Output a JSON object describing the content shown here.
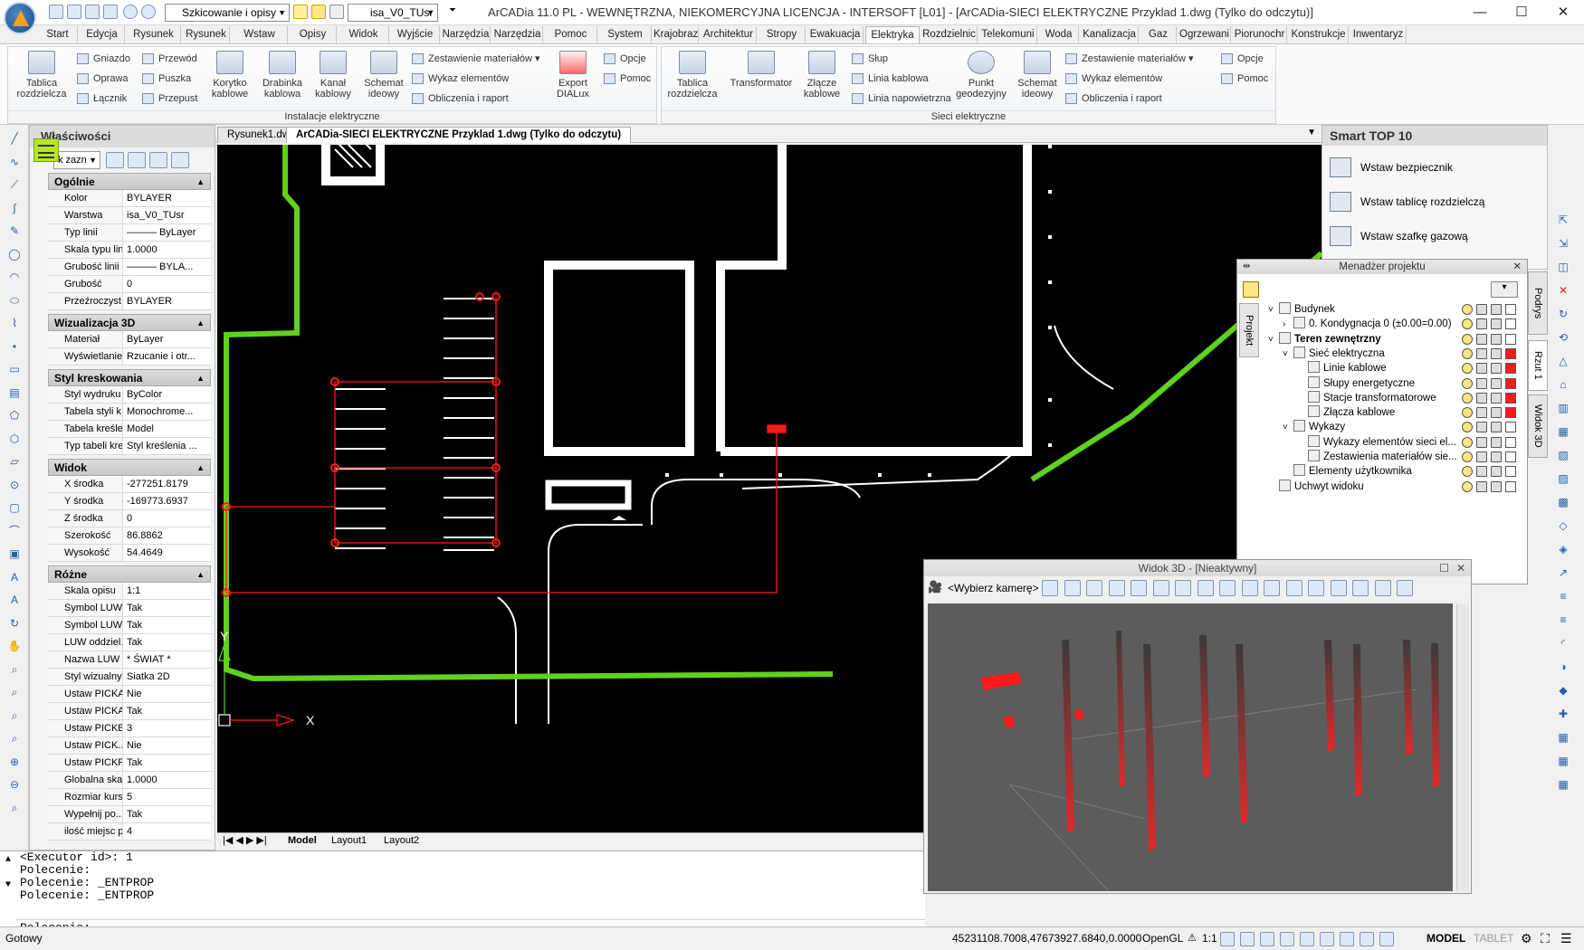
{
  "window": {
    "title": "ArCADia 11.0 PL - WEWNĘTRZNA, NIEKOMERCYJNA LICENCJA - INTERSOFT [L01] - [ArCADia-SIECI ELEKTRYCZNE Przyklad 1.dwg (Tylko do odczytu)]",
    "workspace": "Szkicowanie i opisy",
    "layer": "isa_V0_TUsr",
    "minimize": "—",
    "maximize": "☐",
    "close": "✕"
  },
  "ribbon_tabs": [
    "Start",
    "Edycja",
    "Rysunek 2D",
    "Rysunek 3D",
    "Wstaw",
    "Opisy",
    "Widok",
    "Wyjście",
    "Narzędzia",
    "Narzędzia e",
    "Pomoc",
    "System",
    "Krajobraz",
    "Architektur",
    "Stropy",
    "Ewakuacja",
    "Elektryka",
    "Rozdzielnic",
    "Telekomuni",
    "Woda",
    "Kanalizacja",
    "Gaz",
    "Ogrzewani",
    "Piorunochr",
    "Konstrukcje",
    "Inwentaryz"
  ],
  "ribbon": {
    "group1": {
      "label": "Instalacje elektryczne",
      "tablica": "Tablica rozdzielcza",
      "gniazdo": "Gniazdo",
      "oprawa": "Oprawa",
      "lacznik": "Łącznik",
      "przewod": "Przewód",
      "puszka": "Puszka",
      "przepust": "Przepust",
      "korytko": "Korytko kablowe",
      "drabinka": "Drabinka kablowa",
      "kanal": "Kanał kablowy",
      "schemat": "Schemat ideowy",
      "zestawienie": "Zestawienie materiałów",
      "wykaz": "Wykaz elementów",
      "obliczenia": "Obliczenia i raport",
      "export": "Export DIALux",
      "opcje": "Opcje",
      "pomoc": "Pomoc"
    },
    "group2": {
      "label": "Sieci elektryczne",
      "tablica": "Tablica rozdzielcza",
      "transformator": "Transformator",
      "zlacze": "Złącze kablowe",
      "slup": "Słup",
      "linia_kablowa": "Linia kablowa",
      "linia_napowietrzna": "Linia napowietrzna",
      "punkt": "Punkt geodezyjny",
      "schemat": "Schemat ideowy",
      "zestawienie": "Zestawienie materiałów",
      "wykaz": "Wykaz elementów",
      "obliczenia": "Obliczenia i raport",
      "opcje": "Opcje",
      "pomoc": "Pomoc"
    }
  },
  "properties": {
    "title": "Właściwości",
    "selector": "k zazn",
    "sections": [
      {
        "name": "Ogólnie",
        "rows": [
          [
            "Kolor",
            "BYLAYER"
          ],
          [
            "Warstwa",
            "isa_V0_TUsr"
          ],
          [
            "Typ linii",
            "——— ByLayer"
          ],
          [
            "Skala typu linii",
            "1.0000"
          ],
          [
            "Grubość linii",
            "——— BYLA..."
          ],
          [
            "Grubość",
            "0"
          ],
          [
            "Przeźroczyst...",
            "BYLAYER"
          ]
        ]
      },
      {
        "name": "Wizualizacja 3D",
        "rows": [
          [
            "Materiał",
            "ByLayer"
          ],
          [
            "Wyświetlanie...",
            "Rzucanie i otr..."
          ]
        ]
      },
      {
        "name": "Styl kreskowania",
        "rows": [
          [
            "Styl wydruku",
            "ByColor"
          ],
          [
            "Tabela styli k...",
            "Monochrome..."
          ],
          [
            "Tabela kreśle...",
            "Model"
          ],
          [
            "Typ tabeli kre...",
            "Styl kreślenia ..."
          ]
        ]
      },
      {
        "name": "Widok",
        "rows": [
          [
            "X środka",
            "-277251.8179"
          ],
          [
            "Y środka",
            "-169773.6937"
          ],
          [
            "Z środka",
            "0"
          ],
          [
            "Szerokość",
            "86.8862"
          ],
          [
            "Wysokość",
            "54.4649"
          ]
        ]
      },
      {
        "name": "Różne",
        "rows": [
          [
            "Skala opisu",
            "1:1"
          ],
          [
            "Symbol LUW...",
            "Tak"
          ],
          [
            "Symbol LUW...",
            "Tak"
          ],
          [
            "LUW oddziel...",
            "Tak"
          ],
          [
            "Nazwa LUW",
            "* ŚWIAT *"
          ],
          [
            "Styl wizualny",
            "Siatka 2D"
          ],
          [
            "Ustaw PICKA...",
            "Nie"
          ],
          [
            "Ustaw PICKA...",
            "Tak"
          ],
          [
            "Ustaw PICKB...",
            "3"
          ],
          [
            "Ustaw PICK...",
            "Nie"
          ],
          [
            "Ustaw PICKF...",
            "Tak"
          ],
          [
            "Globalna skal...",
            "1.0000"
          ],
          [
            "Rozmiar kurs...",
            "5"
          ],
          [
            "Wypełnij po...",
            "Tak"
          ],
          [
            "ilość miejsc p...",
            "4"
          ]
        ]
      }
    ]
  },
  "doc_tabs": [
    "Rysunek1.dwg",
    "ArCADia-SIECI ELEKTRYCZNE Przyklad 1.dwg (Tylko do odczytu)"
  ],
  "layout_tabs": [
    "Model",
    "Layout1",
    "Layout2"
  ],
  "ucs": {
    "x": "X",
    "y": "Y"
  },
  "command_line": {
    "history": [
      "<Executor id>: 1",
      "Polecenie:",
      "Polecenie: _ENTPROP",
      "Polecenie: _ENTPROP"
    ],
    "prompt": "Polecenie:"
  },
  "status": {
    "ready": "Gotowy",
    "coords": "45231108.7008,47673927.6840,0.0000",
    "renderer": "OpenGL",
    "scale": "1:1",
    "model": "MODEL",
    "tablet": "TABLET"
  },
  "smart_top": {
    "title": "Smart TOP 10",
    "items": [
      "Wstaw bezpiecznik",
      "Wstaw tablicę rozdzielczą",
      "Wstaw szafkę gazową"
    ]
  },
  "project_manager": {
    "title": "Menadżer projektu",
    "tab": "Projekt",
    "rows": [
      {
        "label": "Budynek",
        "level": 0,
        "bold": false,
        "exp": "˅",
        "red": false
      },
      {
        "label": "0. Kondygnacja 0 (±0.00=0.00)",
        "level": 1,
        "bold": false,
        "exp": "›",
        "red": false
      },
      {
        "label": "Teren zewnętrzny",
        "level": 0,
        "bold": true,
        "exp": "˅",
        "red": false
      },
      {
        "label": "Sieć elektryczna",
        "level": 1,
        "bold": false,
        "exp": "˅",
        "red": true
      },
      {
        "label": "Linie kablowe",
        "level": 2,
        "bold": false,
        "exp": "",
        "red": true
      },
      {
        "label": "Słupy energetyczne",
        "level": 2,
        "bold": false,
        "exp": "",
        "red": true
      },
      {
        "label": "Stacje transformatorowe",
        "level": 2,
        "bold": false,
        "exp": "",
        "red": true
      },
      {
        "label": "Złącza kablowe",
        "level": 2,
        "bold": false,
        "exp": "",
        "red": true
      },
      {
        "label": "Wykazy",
        "level": 1,
        "bold": false,
        "exp": "˅",
        "red": false
      },
      {
        "label": "Wykazy elementów sieci el...",
        "level": 2,
        "bold": false,
        "exp": "",
        "red": false
      },
      {
        "label": "Zestawienia materiałów sie...",
        "level": 2,
        "bold": false,
        "exp": "",
        "red": false
      },
      {
        "label": "Elementy użytkownika",
        "level": 1,
        "bold": false,
        "exp": "",
        "red": false
      },
      {
        "label": "Uchwyt widoku",
        "level": 0,
        "bold": false,
        "exp": "",
        "red": false
      }
    ]
  },
  "right_tabs": [
    "Podrys",
    "Rzut 1",
    "Widok 3D"
  ],
  "view3d": {
    "title": "Widok 3D - [Nieaktywny]",
    "camera": "<Wybierz kamerę>"
  },
  "colors": {
    "accent_red": "#ff1a1a",
    "green_line": "#5fd21e",
    "selection": "#b7e52a"
  }
}
